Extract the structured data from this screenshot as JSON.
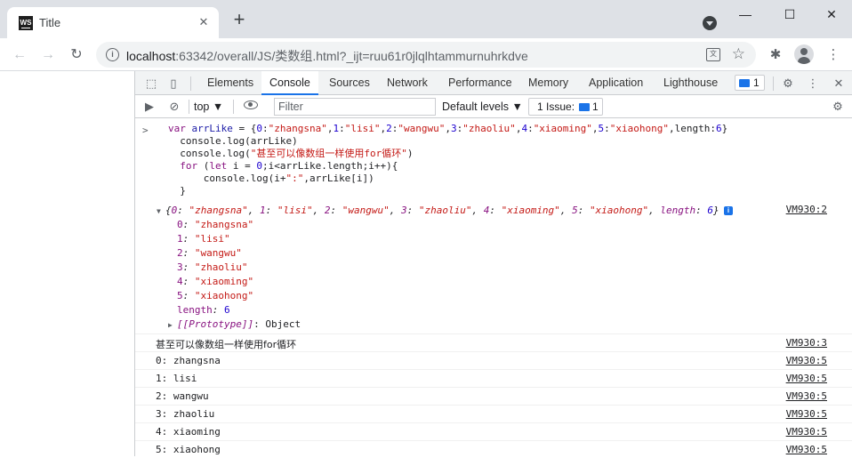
{
  "browser": {
    "tab_title": "Title",
    "tab_favicon_text": "WS",
    "url_host": "localhost",
    "url_rest": ":63342/overall/JS/类数组.html?_ijt=ruu61r0jlqlhtammurnuhrkdve"
  },
  "devtools": {
    "tabs": [
      "Elements",
      "Console",
      "Sources",
      "Network",
      "Performance",
      "Memory",
      "Application",
      "Lighthouse"
    ],
    "active_tab": "Console",
    "issues_count": "1",
    "context": "top",
    "filter_placeholder": "Filter",
    "levels_label": "Default levels",
    "issue_label": "1 Issue:",
    "issue_count": "1"
  },
  "console": {
    "code_lines": [
      "var arrLike = {0:\"zhangsna\",1:\"lisi\",2:\"wangwu\",3:\"zhaoliu\",4:\"xiaoming\",5:\"xiaohong\",length:6}",
      "  console.log(arrLike)",
      "  console.log(\"甚至可以像数组一样使用for循环\")",
      "  for (let i = 0;i<arrLike.length;i++){",
      "      console.log(i+\":\",arrLike[i])",
      "  }"
    ],
    "object_preview": "{0: \"zhangsna\", 1: \"lisi\", 2: \"wangwu\", 3: \"zhaoliu\", 4: \"xiaoming\", 5: \"xiaohong\", length: 6}",
    "object_source": "VM930:2",
    "object_props": [
      {
        "key": "0",
        "value": "\"zhangsna\""
      },
      {
        "key": "1",
        "value": "\"lisi\""
      },
      {
        "key": "2",
        "value": "\"wangwu\""
      },
      {
        "key": "3",
        "value": "\"zhaoliu\""
      },
      {
        "key": "4",
        "value": "\"xiaoming\""
      },
      {
        "key": "5",
        "value": "\"xiaohong\""
      },
      {
        "key": "length",
        "value": "6"
      }
    ],
    "prototype_key": "[[Prototype]]",
    "prototype_value": "Object",
    "log_rows": [
      {
        "text": "甚至可以像数组一样使用for循环",
        "source": "VM930:3"
      },
      {
        "text": "0: zhangsna",
        "source": "VM930:5"
      },
      {
        "text": "1: lisi",
        "source": "VM930:5"
      },
      {
        "text": "2: wangwu",
        "source": "VM930:5"
      },
      {
        "text": "3: zhaoliu",
        "source": "VM930:5"
      },
      {
        "text": "4: xiaoming",
        "source": "VM930:5"
      },
      {
        "text": "5: xiaohong",
        "source": "VM930:5"
      }
    ]
  }
}
